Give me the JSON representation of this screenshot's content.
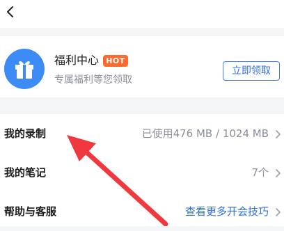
{
  "nav": {
    "back_icon": "chevron-left-icon"
  },
  "welfare": {
    "title": "福利中心",
    "badge": "HOT",
    "subtitle": "专属福利等您领取",
    "claim_label": "立即领取",
    "icon": "gift-icon",
    "colors": {
      "icon_bg": "#3d8bf5",
      "badge_bg": "#ff6a2a",
      "accent": "#2f6fe0"
    }
  },
  "menu": {
    "items": [
      {
        "label": "我的录制",
        "value": "已使用476 MB / 1024 MB"
      },
      {
        "label": "我的笔记",
        "value": "7个"
      },
      {
        "label": "帮助与客服",
        "value": "查看更多开会技巧"
      }
    ]
  },
  "annotation": {
    "color": "#f0393e",
    "icon": "red-arrow-annotation"
  }
}
